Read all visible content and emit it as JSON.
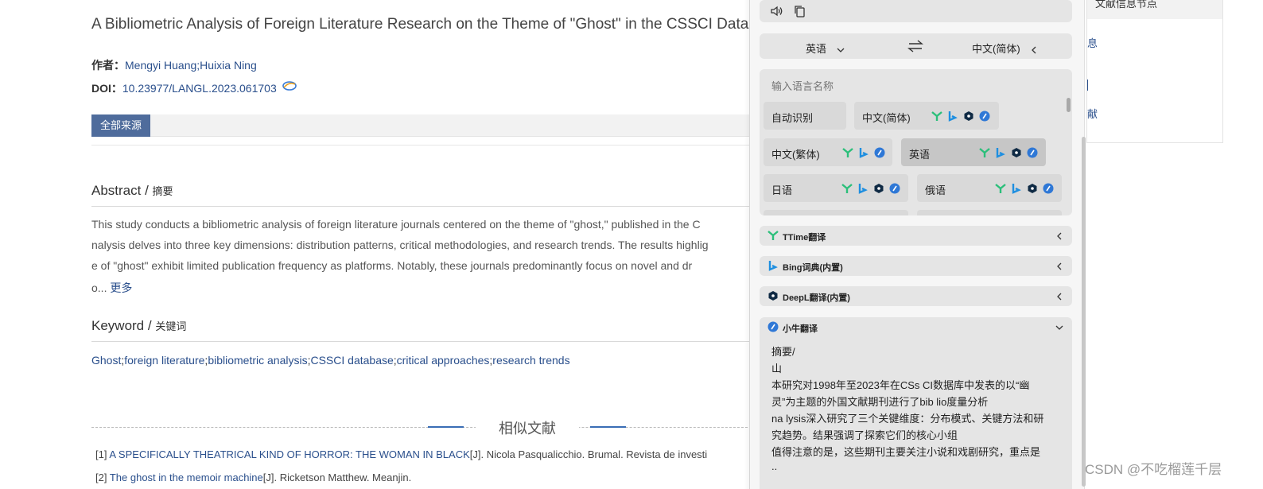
{
  "article": {
    "title": "A Bibliometric Analysis of Foreign Literature Research on the Theme of \"Ghost\" in the CSSCI Datab",
    "authors_label": "作者：",
    "authors": "Mengyi Huang;Huixia Ning",
    "doi_label": "DOI：",
    "doi": "10.23977/LANGL.2023.061703",
    "source_tab": "全部来源",
    "abstract_heading_en": "Abstract / ",
    "abstract_heading_zh": "摘要",
    "abstract_lines": [
      "This study conducts a bibliometric analysis of foreign literature journals centered on the theme of \"ghost,\" published in the C",
      "nalysis delves into three key dimensions: distribution patterns, critical methodologies, and research trends. The results highlig",
      "e of \"ghost\" exhibit limited publication frequency as platforms. Notably, these journals predominantly focus on novel and dr"
    ],
    "abstract_tail": "o... ",
    "abstract_more": "更多",
    "keyword_heading_en": "Keyword / ",
    "keyword_heading_zh": "关键词",
    "keywords": [
      "Ghost",
      "foreign literature",
      "bibliometric analysis",
      "CSSCI database",
      "critical approaches",
      "research trends"
    ],
    "similar_title": "相似文献",
    "references": [
      {
        "num": "[1] ",
        "link": "A SPECIFICALLY THEATRICAL KIND OF HORROR: THE WOMAN IN BLACK",
        "rest": "[J]. Nicola Pasqualicchio.  Brumal. Revista de investi"
      },
      {
        "num": "[2] ",
        "link": "The ghost in the memoir machine",
        "rest": "[J]. Ricketson Matthew.  Meanjin."
      }
    ]
  },
  "sidebar": {
    "header": "文献信息节点",
    "fragments": [
      "息",
      "",
      "献"
    ]
  },
  "watermark": "CSDN @不吃榴莲千层",
  "translator": {
    "source_lang": "英语",
    "target_lang": "中文(简体)",
    "search_placeholder": "输入语言名称",
    "languages": [
      {
        "label": "自动识别",
        "engines": []
      },
      {
        "label": "中文(简体)",
        "engines": [
          "ttime",
          "bing",
          "deepl",
          "niutrans"
        ]
      },
      {
        "label": "中文(繁体)",
        "engines": [
          "ttime",
          "bing",
          "niutrans"
        ]
      },
      {
        "label": "英语",
        "engines": [
          "ttime",
          "bing",
          "deepl",
          "niutrans"
        ],
        "selected": true
      },
      {
        "label": "日语",
        "engines": [
          "ttime",
          "bing",
          "deepl",
          "niutrans"
        ]
      },
      {
        "label": "俄语",
        "engines": [
          "ttime",
          "bing",
          "deepl",
          "niutrans"
        ]
      }
    ],
    "engines": [
      {
        "id": "ttime",
        "label": "TTime翻译",
        "expanded": false
      },
      {
        "id": "bing",
        "label": "Bing词典(内置)",
        "expanded": false
      },
      {
        "id": "deepl",
        "label": "DeepL翻译(内置)",
        "expanded": false
      },
      {
        "id": "niutrans",
        "label": "小牛翻译",
        "expanded": true
      }
    ],
    "result_lines": [
      "摘要/",
      "山",
      "本研究对1998年至2023年在CSs CI数据库中发表的以“幽",
      "灵”为主题的外国文献期刊进行了bib lio度量分析",
      "na lysis深入研究了三个关键维度：分布模式、关键方法和研",
      "究趋势。结果强调了探索它们的核心小组",
      "值得注意的是，这些期刊主要关注小说和戏剧研究，重点是",
      ".."
    ],
    "colors": {
      "ttime": "#2bbf7a",
      "bing": "#1f8fe0",
      "deepl": "#0f2a44",
      "niutrans": "#2f78d6"
    }
  }
}
